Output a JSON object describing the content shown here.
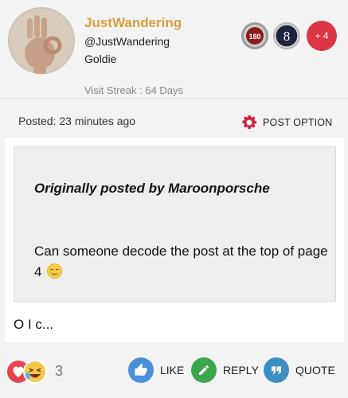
{
  "profile": {
    "username": "JustWandering",
    "handle": "@JustWandering",
    "rank": "Goldie",
    "streak": "Visit Streak : 64 Days",
    "avatar": "avatar-ok-hand-icon"
  },
  "badges": [
    {
      "label": "180",
      "icon": "badge-180-icon"
    },
    {
      "label": "8",
      "icon": "badge-8-icon"
    },
    {
      "label": "+ 4",
      "color": "#dc3545"
    }
  ],
  "post_meta": {
    "posted": "Posted: 23 minutes ago",
    "option_label": "POST OPTION",
    "option_icon": "gear-icon",
    "option_color": "#d0233b"
  },
  "quote": {
    "author": "Originally posted by Maroonporsche",
    "text": "Can someone decode the post at the top of page 4",
    "emoji": "relieved-face-icon"
  },
  "post_body": "O I c...",
  "footer": {
    "reaction_count": "3",
    "reaction_icons": [
      "heart-icon",
      "laughing-face-icon"
    ],
    "like_label": "LIKE",
    "reply_label": "REPLY",
    "quote_label": "QUOTE",
    "like_color": "#4a90d9",
    "reply_color": "#3aa84a",
    "quote_color": "#3b8fc4"
  }
}
